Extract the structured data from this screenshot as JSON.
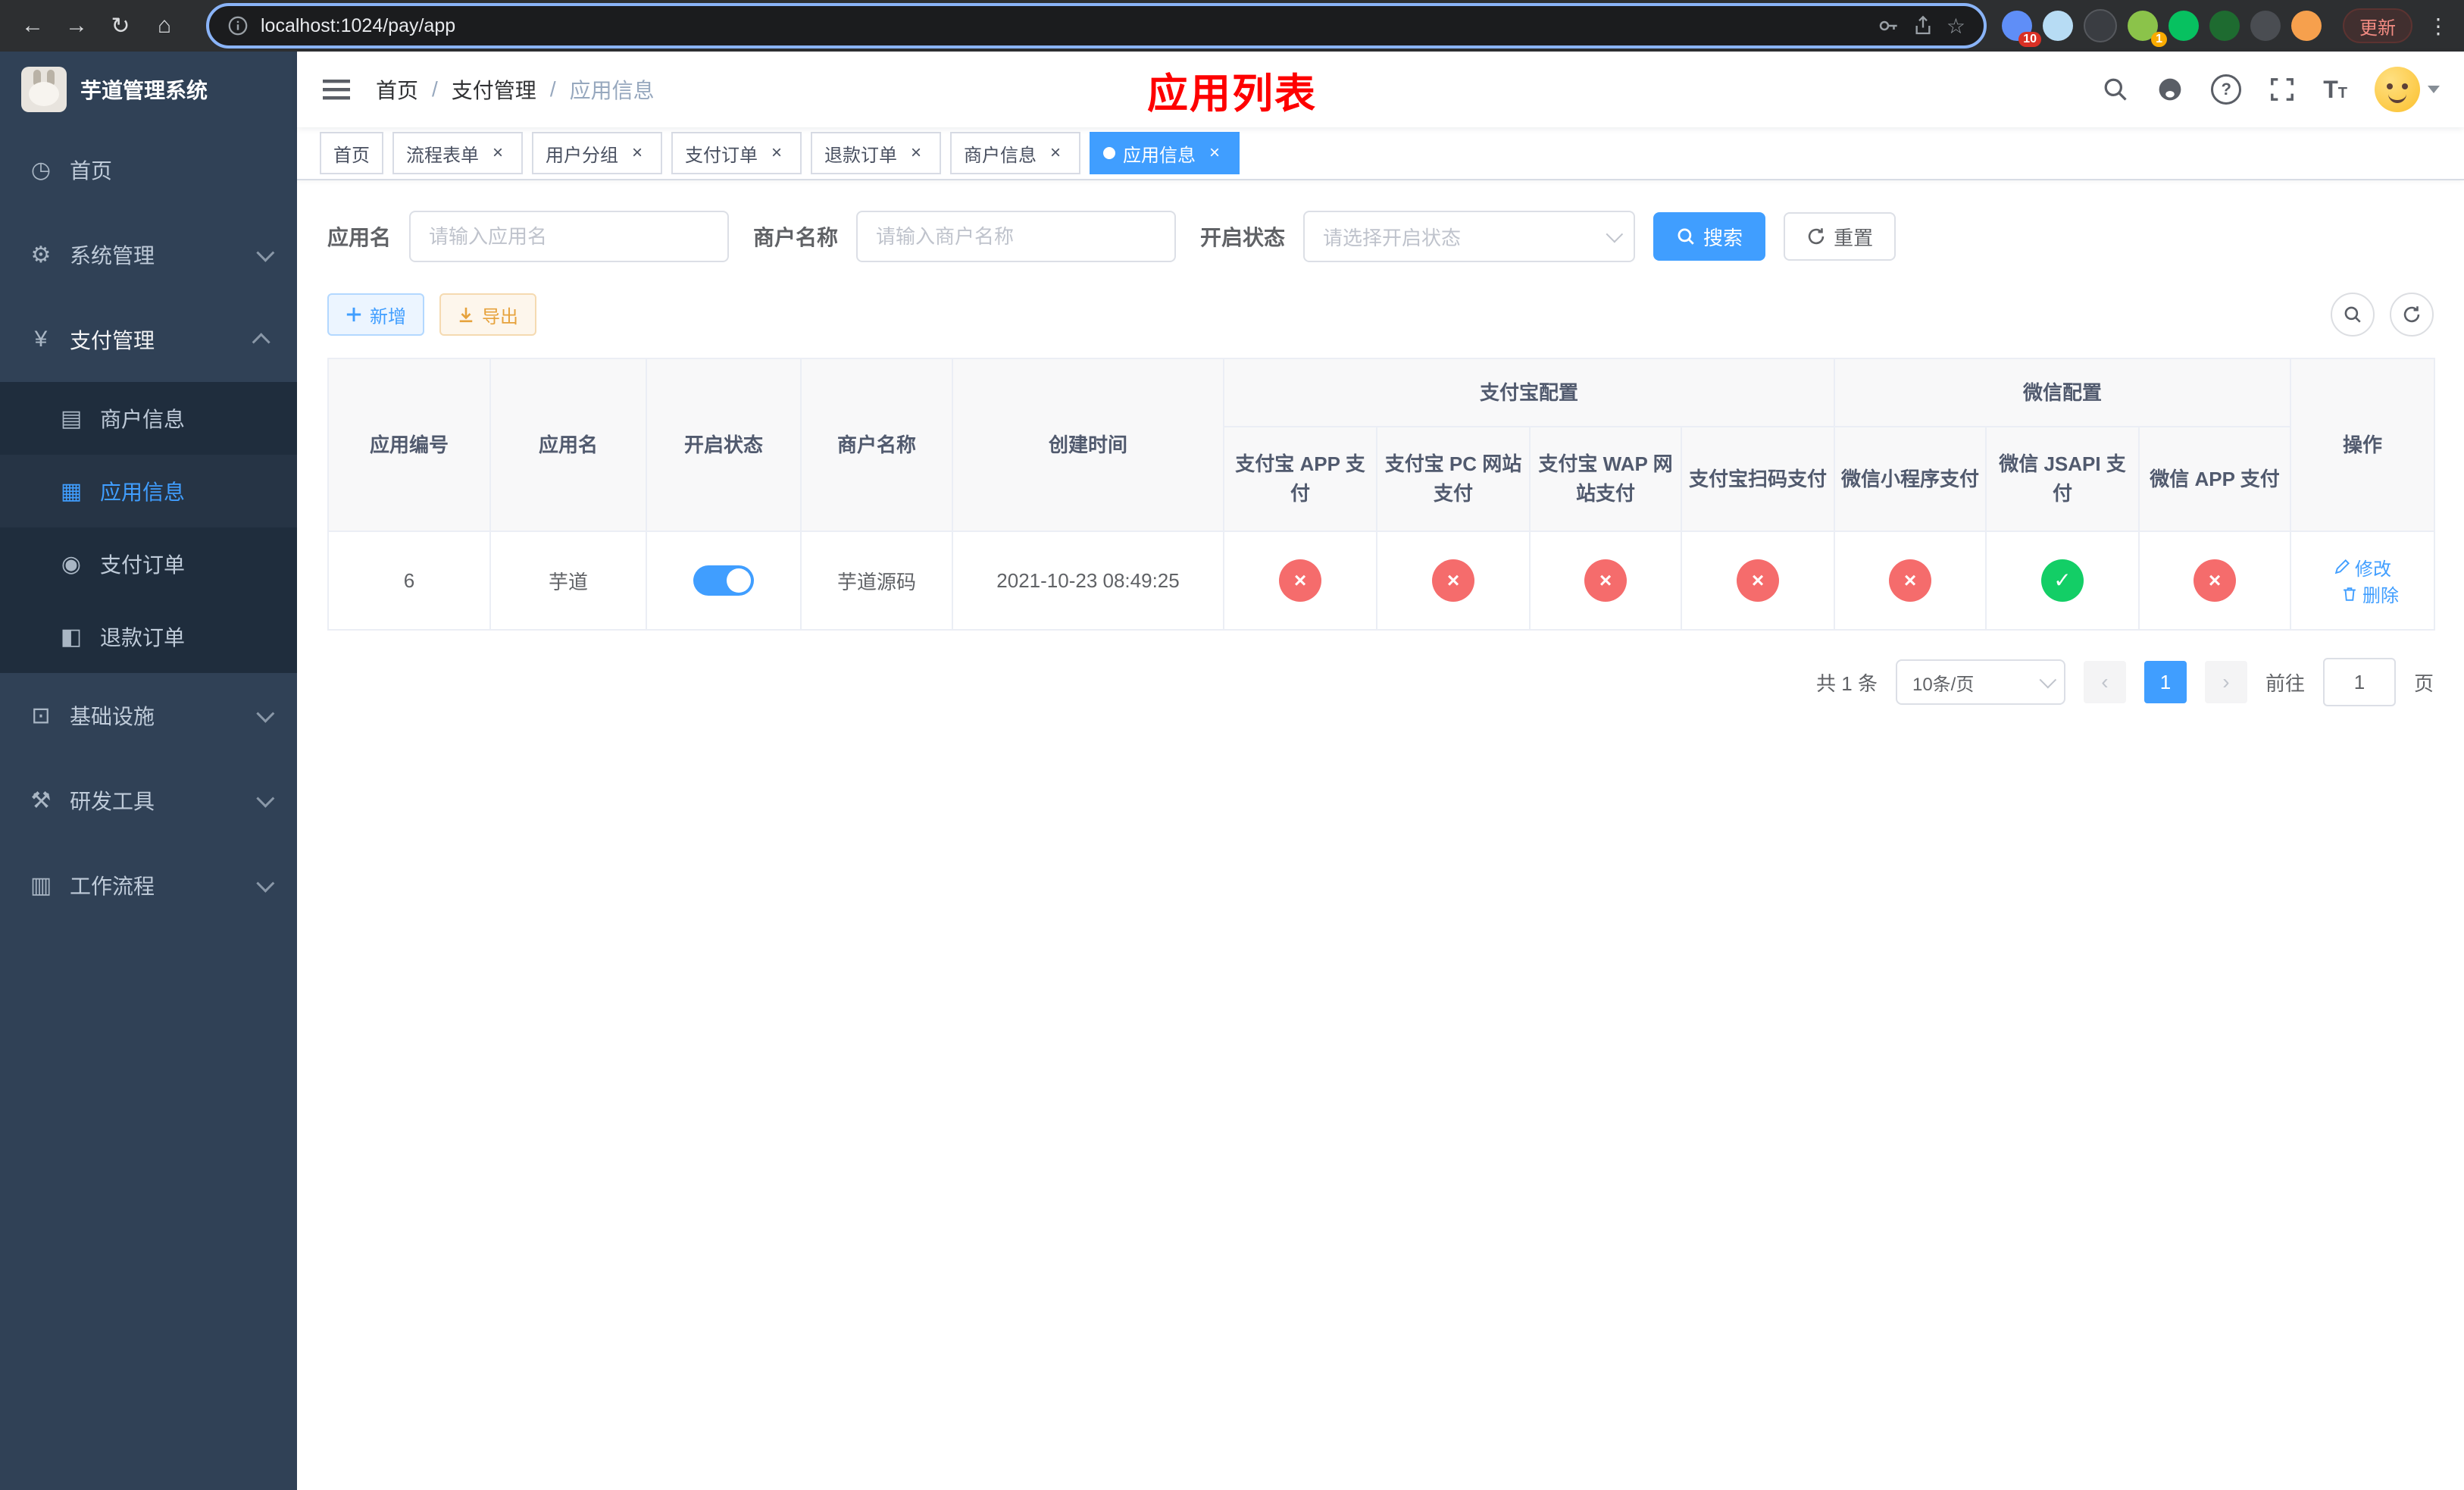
{
  "browser": {
    "url": "localhost:1024/pay/app",
    "update_label": "更新",
    "extensions": [
      {
        "name": "blue-grid-extension",
        "badge": "10"
      },
      {
        "name": "droplet-extension"
      },
      {
        "name": "dark-circle-extension"
      },
      {
        "name": "green-leaf-extension",
        "badge": "1"
      },
      {
        "name": "wechat-extension"
      },
      {
        "name": "green-docs-extension"
      },
      {
        "name": "pin-extension"
      },
      {
        "name": "face-extension"
      }
    ]
  },
  "icons": {
    "back": "←",
    "forward": "→",
    "reload": "↻",
    "home_nav": "⌂",
    "star": "☆",
    "home": "◷",
    "system": "⚙",
    "payment": "¥",
    "merchant_info": "▤",
    "app_info": "▦",
    "pay_order": "◉",
    "refund_order": "◧",
    "infrastructure": "⊡",
    "devtools": "⚒",
    "workflow": "▥",
    "check": "✓",
    "cross": "×"
  },
  "sidebar": {
    "logo_title": "芋道管理系统",
    "menu": {
      "home": "首页",
      "system": "系统管理",
      "payment": "支付管理",
      "infrastructure": "基础设施",
      "devtools": "研发工具",
      "workflow": "工作流程"
    },
    "payment_children": {
      "merchant_info": "商户信息",
      "app_info": "应用信息",
      "pay_order": "支付订单",
      "refund_order": "退款订单"
    }
  },
  "header": {
    "breadcrumb": [
      "首页",
      "支付管理",
      "应用信息"
    ],
    "page_title": "应用列表"
  },
  "tabs": [
    {
      "label": "首页"
    },
    {
      "label": "流程表单"
    },
    {
      "label": "用户分组"
    },
    {
      "label": "支付订单"
    },
    {
      "label": "退款订单"
    },
    {
      "label": "商户信息"
    },
    {
      "label": "应用信息"
    }
  ],
  "filters": {
    "app_name_label": "应用名",
    "app_name_placeholder": "请输入应用名",
    "merchant_label": "商户名称",
    "merchant_placeholder": "请输入商户名称",
    "status_label": "开启状态",
    "status_placeholder": "请选择开启状态",
    "search_label": "搜索",
    "reset_label": "重置"
  },
  "toolbar": {
    "add_label": "新增",
    "export_label": "导出"
  },
  "table": {
    "headers": {
      "app_id": "应用编号",
      "app_name": "应用名",
      "status": "开启状态",
      "merchant": "商户名称",
      "created": "创建时间",
      "alipay_group": "支付宝配置",
      "alipay_cols": [
        "支付宝 APP 支付",
        "支付宝 PC 网站支付",
        "支付宝 WAP 网站支付",
        "支付宝扫码支付"
      ],
      "wechat_group": "微信配置",
      "wechat_cols": [
        "微信小程序支付",
        "微信 JSAPI 支付",
        "微信 APP 支付"
      ],
      "actions": "操作"
    },
    "row": {
      "app_id": "6",
      "app_name": "芋道",
      "status_on": true,
      "merchant": "芋道源码",
      "created": "2021-10-23 08:49:25",
      "configs": [
        "no",
        "no",
        "no",
        "no",
        "no",
        "yes",
        "no"
      ],
      "edit_label": "修改",
      "delete_label": "删除"
    }
  },
  "pagination": {
    "total_text": "共 1 条",
    "page_size": "10条/页",
    "current_page": "1",
    "goto_label": "前往",
    "goto_value": "1",
    "page_suffix": "页"
  },
  "colors": {
    "accent": "#409eff",
    "error": "#f56c6c",
    "success": "#13ce66",
    "page_title_red": "#fe0000",
    "sidebar_bg": "#304156",
    "sidebar_sub_bg": "#1f2d3d"
  }
}
